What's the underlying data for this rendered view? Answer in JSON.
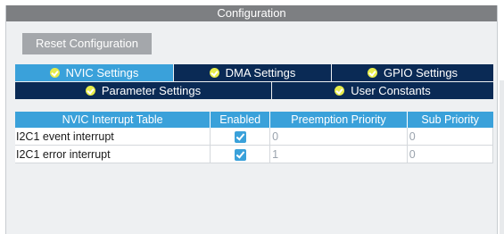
{
  "window": {
    "title": "Configuration"
  },
  "reset_button": {
    "label": "Reset Configuration"
  },
  "tabs": {
    "row1": [
      {
        "label": "NVIC Settings",
        "active": true
      },
      {
        "label": "DMA Settings",
        "active": false
      },
      {
        "label": "GPIO Settings",
        "active": false
      }
    ],
    "row2": [
      {
        "label": "Parameter Settings",
        "active": false
      },
      {
        "label": "User Constants",
        "active": false
      }
    ]
  },
  "table": {
    "headers": [
      "NVIC Interrupt Table",
      "Enabled",
      "Preemption Priority",
      "Sub Priority"
    ],
    "rows": [
      {
        "name": "I2C1 event interrupt",
        "enabled": true,
        "preemption": "0",
        "sub": "0"
      },
      {
        "name": "I2C1 error interrupt",
        "enabled": true,
        "preemption": "1",
        "sub": "0"
      }
    ]
  },
  "colors": {
    "titlebar": "#7d7f82",
    "tab_active": "#3aa1da",
    "tab_inactive": "#0a2a55",
    "check_icon": "#e7ec4b"
  }
}
